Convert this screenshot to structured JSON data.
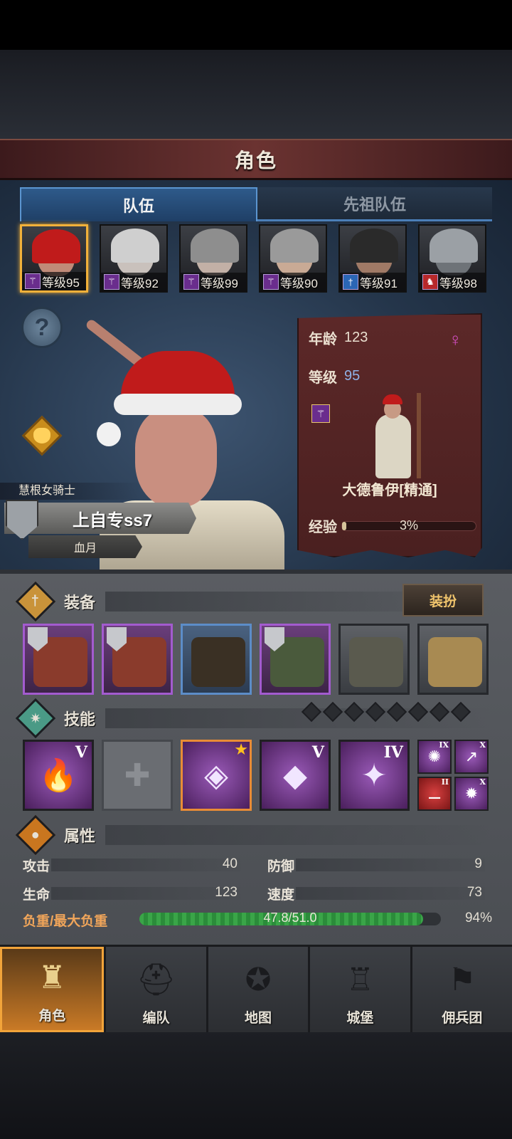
{
  "header": {
    "title": "角色"
  },
  "tabs": [
    {
      "label": "队伍",
      "active": true
    },
    {
      "label": "先祖队伍",
      "active": false
    }
  ],
  "roster": [
    {
      "level_text": "等级95",
      "class_icon": "staff-icon",
      "selected": true,
      "hair": "#c01b1b",
      "skin": "#c08a78"
    },
    {
      "level_text": "等级92",
      "class_icon": "staff-icon",
      "selected": false,
      "hair": "#cfcfcf",
      "skin": "#c9c1bc"
    },
    {
      "level_text": "等级99",
      "class_icon": "staff-icon",
      "selected": false,
      "hair": "#8e8e8e",
      "skin": "#c2b0a6"
    },
    {
      "level_text": "等级90",
      "class_icon": "staff-icon",
      "selected": false,
      "hair": "#9a9a9a",
      "skin": "#c9aa95"
    },
    {
      "level_text": "等级91",
      "class_icon": "sword-icon",
      "selected": false,
      "hair": "#2a2a2a",
      "skin": "#a07a66"
    },
    {
      "level_text": "等级98",
      "class_icon": "horse-icon",
      "selected": false,
      "hair": "#9ba0a5",
      "skin": "#6e7378"
    }
  ],
  "hero": {
    "title": "慧根女骑士",
    "name": "上自专ss7",
    "guild": "血月"
  },
  "info": {
    "age_label": "年龄",
    "age": "123",
    "level_label": "等级",
    "level": "95",
    "gender_icon": "female-icon",
    "class_name": "大德鲁伊[精通]",
    "exp_label": "经验",
    "exp_text": "3%",
    "exp_fraction": 0.03
  },
  "equipment": {
    "title": "装备",
    "dress_label": "装扮",
    "slots": [
      {
        "rarity": "epic",
        "icon": "gauntlet-icon",
        "soulbound": true
      },
      {
        "rarity": "epic",
        "icon": "gauntlet-icon",
        "soulbound": true
      },
      {
        "rarity": "rare",
        "icon": "hood-icon",
        "soulbound": false
      },
      {
        "rarity": "epic",
        "icon": "fur-coat-icon",
        "soulbound": true
      },
      {
        "rarity": "normal",
        "icon": "boots-icon",
        "soulbound": false
      },
      {
        "rarity": "normal",
        "icon": "ring-icon",
        "soulbound": false
      }
    ]
  },
  "skills": {
    "title": "技能",
    "pip_count": 8,
    "items": [
      {
        "icon": "flame-icon",
        "rank": "V",
        "empty": false,
        "selected": false
      },
      {
        "icon": "cross-icon",
        "rank": "",
        "empty": true,
        "selected": false
      },
      {
        "icon": "crystal-tornado-icon",
        "rank": "",
        "empty": false,
        "selected": true
      },
      {
        "icon": "crystal-hand-icon",
        "rank": "V",
        "empty": false,
        "selected": false
      },
      {
        "icon": "holy-spear-icon",
        "rank": "IV",
        "empty": false,
        "selected": false
      }
    ],
    "mini": [
      {
        "icon": "sun-target-icon",
        "rank": "IX",
        "color": "purple"
      },
      {
        "icon": "spear-icon",
        "rank": "X",
        "color": "purple"
      },
      {
        "icon": "dumbbell-icon",
        "rank": "II",
        "color": "red"
      },
      {
        "icon": "burst-icon",
        "rank": "X",
        "color": "purple"
      }
    ]
  },
  "attributes": {
    "title": "属性",
    "attack_label": "攻击",
    "attack": "40",
    "defense_label": "防御",
    "defense": "9",
    "hp_label": "生命",
    "hp": "123",
    "speed_label": "速度",
    "speed": "73",
    "load_label": "负重/最大负重",
    "load_text": "47.8/51.0",
    "load_pct": "94%",
    "load_fraction": 0.94
  },
  "nav": [
    {
      "label": "角色",
      "icon": "knight-icon",
      "active": true
    },
    {
      "label": "编队",
      "icon": "helmet-icon",
      "active": false
    },
    {
      "label": "地图",
      "icon": "compass-icon",
      "active": false
    },
    {
      "label": "城堡",
      "icon": "castle-icon",
      "active": false
    },
    {
      "label": "佣兵团",
      "icon": "banner-icon",
      "active": false
    }
  ]
}
